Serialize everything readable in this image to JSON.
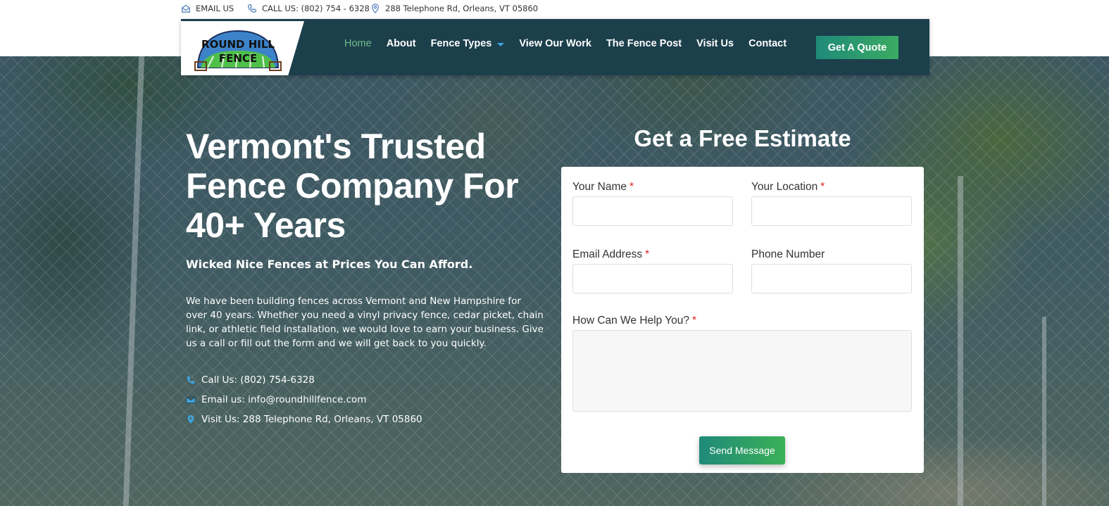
{
  "topbar": {
    "email": "EMAIL US",
    "phone": "CALL US: (802) 754 - 6328",
    "address": "288 Telephone Rd, Orleans, VT 05860"
  },
  "logo": {
    "line1": "ROUND HILL",
    "line2": "FENCE"
  },
  "nav": {
    "items": [
      "Home",
      "About",
      "Fence Types",
      "View Our Work",
      "The Fence Post",
      "Visit Us",
      "Contact"
    ],
    "quote": "Get A Quote"
  },
  "hero": {
    "headline": [
      "Vermont's Trusted",
      "Fence Company For",
      "40+ Years"
    ],
    "subhead": "Wicked Nice Fences at Prices You Can Afford.",
    "paragraph": "We have been building fences across Vermont and New Hampshire for over 40 years. Whether you need a vinyl privacy fence, cedar picket, chain link, or athletic field installation, we would love to earn your business. Give us a call or fill out the form and we will get back to you quickly.",
    "contacts": [
      "Call Us: (802) 754-6328",
      "Email us: info@roundhillfence.com",
      "Visit Us: 288 Telephone Rd, Orleans, VT 05860"
    ]
  },
  "form": {
    "title": "Get a Free Estimate",
    "name_label": "Your Name",
    "location_label": "Your Location",
    "email_label": "Email Address",
    "phone_label": "Phone Number",
    "help_label": "How Can We Help You?",
    "required_mark": "*",
    "send": "Send Message"
  },
  "colors": {
    "nav_bg": "#1c3f4c",
    "active": "#6fc08a",
    "accent_blue": "#3fa4e0",
    "button_start": "#1f8a7a",
    "button_end": "#3bb056"
  }
}
